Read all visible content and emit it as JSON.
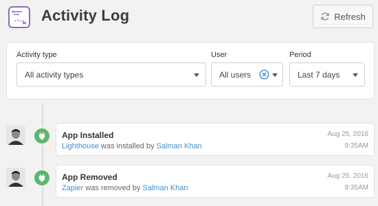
{
  "header": {
    "title": "Activity Log",
    "refresh_label": "Refresh",
    "logo_icon": "activity-log-icon",
    "refresh_icon": "refresh-icon"
  },
  "filters": {
    "activity_type": {
      "label": "Activity type",
      "value": "All activity types"
    },
    "user": {
      "label": "User",
      "value": "All users"
    },
    "period": {
      "label": "Period",
      "value": "Last 7 days"
    }
  },
  "entries": [
    {
      "title": "App Installed",
      "subject": "Lighthouse",
      "action": " was installed by ",
      "user": "Salman Khan",
      "date": "Aug 25, 2016",
      "time": "9:35AM",
      "icon": "plug-icon"
    },
    {
      "title": "App Removed",
      "subject": "Zapier",
      "action": " was removed by ",
      "user": "Salman Khan",
      "date": "Aug 25, 2016",
      "time": "9:35AM",
      "icon": "plug-icon"
    }
  ],
  "colors": {
    "accent": "#3e8ed0",
    "badge": "#5bb86b",
    "logo": "#8e6fb5"
  }
}
